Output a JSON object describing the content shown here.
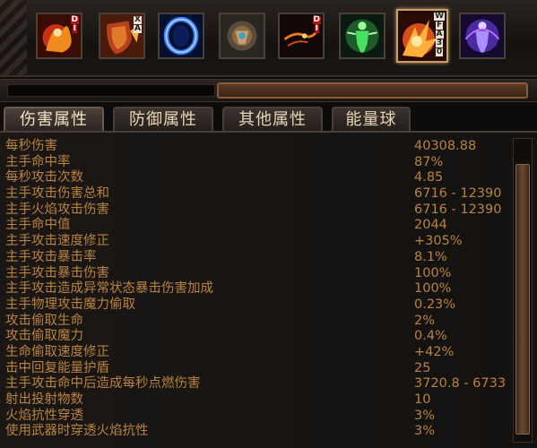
{
  "skills": [
    {
      "icon": "flame-warrior-skill-icon",
      "tags": [
        "D",
        "I"
      ],
      "tag_color": "red"
    },
    {
      "icon": "shield-charge-skill-icon",
      "tags": [
        "X",
        "A"
      ],
      "tag_color": "white"
    },
    {
      "icon": "blue-portal-skill-icon",
      "tags": [],
      "tag_color": ""
    },
    {
      "icon": "mechanical-totem-skill-icon",
      "tags": [],
      "tag_color": ""
    },
    {
      "icon": "fire-arrow-skill-icon",
      "tags": [
        "D",
        "I"
      ],
      "tag_color": "red"
    },
    {
      "icon": "green-aura-figure-skill-icon",
      "tags": [],
      "tag_color": ""
    },
    {
      "icon": "fire-burst-skill-icon",
      "tags": [
        "W",
        "F",
        "A",
        "3",
        "0"
      ],
      "tag_color": "white",
      "selected": true
    },
    {
      "icon": "purple-aura-figure-skill-icon",
      "tags": [],
      "tag_color": ""
    }
  ],
  "tabs": [
    {
      "label": "伤害属性",
      "active": true
    },
    {
      "label": "防御属性",
      "active": false
    },
    {
      "label": "其他属性",
      "active": false
    },
    {
      "label": "能量球",
      "active": false
    }
  ],
  "stats": [
    {
      "label": "每秒伤害",
      "value": "40308.88"
    },
    {
      "label": "主手命中率",
      "value": "87%"
    },
    {
      "label": "每秒攻击次数",
      "value": "4.85"
    },
    {
      "label": "主手攻击伤害总和",
      "value": "6716 - 12390"
    },
    {
      "label": "主手火焰攻击伤害",
      "value": "6716 - 12390"
    },
    {
      "label": "主手命中值",
      "value": "2044"
    },
    {
      "label": "主手攻击速度修正",
      "value": "+305%"
    },
    {
      "label": "主手攻击暴击率",
      "value": "8.1%"
    },
    {
      "label": "主手攻击暴击伤害",
      "value": "100%"
    },
    {
      "label": "主手攻击造成异常状态暴击伤害加成",
      "value": "100%"
    },
    {
      "label": "主手物理攻击魔力偷取",
      "value": "0.23%"
    },
    {
      "label": "攻击偷取生命",
      "value": "2%"
    },
    {
      "label": "攻击偷取魔力",
      "value": "0.4%"
    },
    {
      "label": "生命偷取速度修正",
      "value": "+42%"
    },
    {
      "label": "击中回复能量护盾",
      "value": "25"
    },
    {
      "label": "主手攻击命中后造成每秒点燃伤害",
      "value": "3720.8 - 6733"
    },
    {
      "label": "射出投射物数",
      "value": "10"
    },
    {
      "label": "火焰抗性穿透",
      "value": "3%"
    },
    {
      "label": "使用武器时穿透火焰抗性",
      "value": "3%"
    }
  ],
  "colors": {
    "stat_text": "#b9823e",
    "tab_text": "#e9d6b6",
    "frame": "#4a3f36"
  }
}
